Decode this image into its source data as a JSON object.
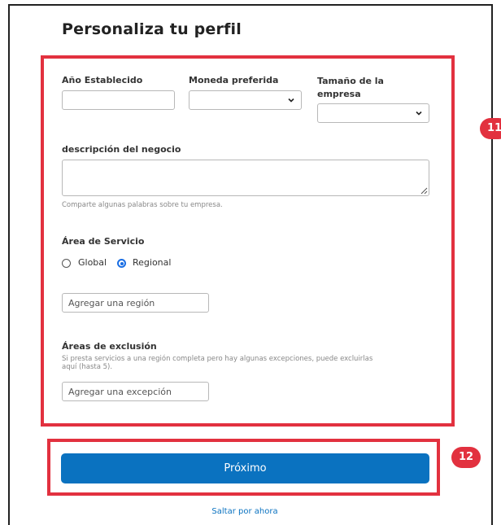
{
  "page": {
    "title": "Personaliza tu perfil"
  },
  "form": {
    "year_label": "Año Establecido",
    "year_value": "",
    "currency_label": "Moneda preferida",
    "currency_value": "",
    "size_label_line1": "Tamaño de la",
    "size_label_line2": "empresa",
    "size_value": "",
    "description_label": "descripción del negocio",
    "description_value": "",
    "description_help": "Comparte algunas palabras sobre tu empresa.",
    "service_area_label": "Área de Servicio",
    "service_area_options": [
      "Global",
      "Regional"
    ],
    "service_area_selected": "Regional",
    "region_placeholder": "Agregar una región",
    "exclusion_label": "Áreas de exclusión",
    "exclusion_help_line1": "Si presta servicios a una región completa pero hay algunas excepciones, puede excluirlas",
    "exclusion_help_line2": "aquí (hasta 5).",
    "exclusion_placeholder": "Agregar una excepción"
  },
  "actions": {
    "next_label": "Próximo",
    "skip_label": "Saltar por ahora"
  },
  "callouts": {
    "form_badge": "11",
    "button_badge": "12"
  },
  "colors": {
    "primary": "#0a72c0",
    "highlight": "#e2313f",
    "radio_selected": "#1a6ee3"
  },
  "icons": {
    "dropdown": "chevron-down-icon",
    "resize": "resize-grip-icon"
  }
}
